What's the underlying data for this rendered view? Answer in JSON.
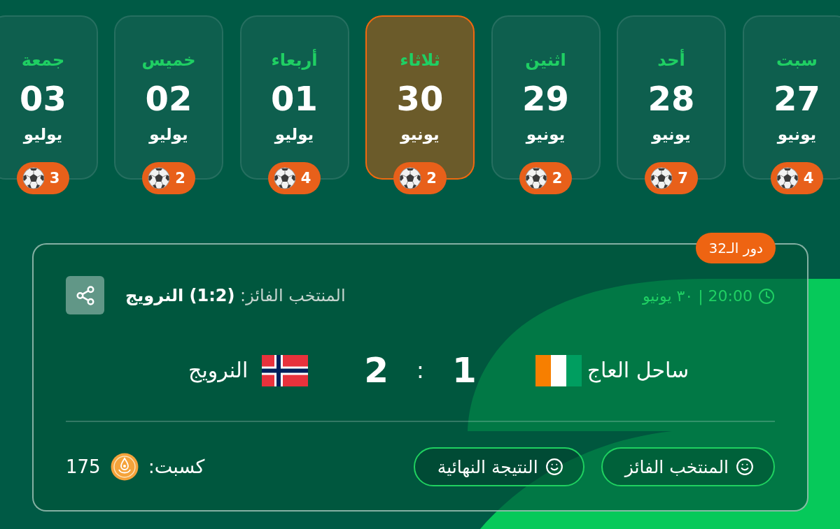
{
  "days": [
    {
      "weekday": "سبت",
      "day": "27",
      "month": "يونيو",
      "matches": "4",
      "selected": false
    },
    {
      "weekday": "أحد",
      "day": "28",
      "month": "يونيو",
      "matches": "7",
      "selected": false
    },
    {
      "weekday": "اثنين",
      "day": "29",
      "month": "يونيو",
      "matches": "2",
      "selected": false
    },
    {
      "weekday": "ثلاثاء",
      "day": "30",
      "month": "يونيو",
      "matches": "2",
      "selected": true
    },
    {
      "weekday": "أربعاء",
      "day": "01",
      "month": "يوليو",
      "matches": "4",
      "selected": false
    },
    {
      "weekday": "خميس",
      "day": "02",
      "month": "يوليو",
      "matches": "2",
      "selected": false
    },
    {
      "weekday": "جمعة",
      "day": "03",
      "month": "يوليو",
      "matches": "3",
      "selected": false
    }
  ],
  "match": {
    "round": "دور الـ32",
    "schedule": "20:00 | ٣٠ يونيو",
    "winner": "المنتخب الفائز: **(1:2) النرويج**",
    "teams": [
      {
        "name": "ساحل العاج",
        "score": "1"
      },
      {
        "name": "النرويج",
        "score": "2"
      }
    ],
    "score_separator": ":",
    "predictions": [
      {
        "label": "المنتخب الفائز"
      },
      {
        "label": "النتيجة النهائية"
      }
    ],
    "earned": {
      "label": "كسبت:",
      "points": "175"
    }
  }
}
